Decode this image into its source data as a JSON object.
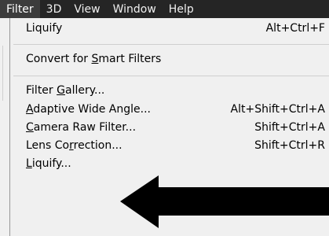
{
  "menubar": {
    "items": [
      {
        "label": "Filter",
        "active": true
      },
      {
        "label": "3D",
        "active": false
      },
      {
        "label": "View",
        "active": false
      },
      {
        "label": "Window",
        "active": false
      },
      {
        "label": "Help",
        "active": false
      }
    ]
  },
  "menu": {
    "last_filter": {
      "label": "Liquify",
      "shortcut": "Alt+Ctrl+F"
    },
    "convert_smart": {
      "pre": "Convert for ",
      "mnemonic": "S",
      "post": "mart Filters"
    },
    "filter_gallery": {
      "pre": "Filter ",
      "mnemonic": "G",
      "post": "allery..."
    },
    "adaptive_wide": {
      "pre": "",
      "mnemonic": "A",
      "post": "daptive Wide Angle...",
      "shortcut": "Alt+Shift+Ctrl+A"
    },
    "camera_raw": {
      "pre": "",
      "mnemonic": "C",
      "post": "amera Raw Filter...",
      "shortcut": "Shift+Ctrl+A"
    },
    "lens_correction": {
      "pre": "Lens Co",
      "mnemonic": "r",
      "post": "rection...",
      "shortcut": "Shift+Ctrl+R"
    },
    "liquify": {
      "pre": "",
      "mnemonic": "L",
      "post": "iquify..."
    }
  },
  "annotation": {
    "arrow_color": "#000000",
    "menubar_color": "#252525",
    "menu_bg": "#f0f0f0"
  }
}
